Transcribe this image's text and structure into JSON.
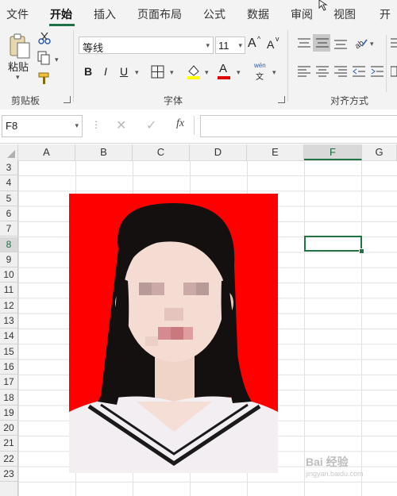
{
  "menu": {
    "tabs": [
      "文件",
      "开始",
      "插入",
      "页面布局",
      "公式",
      "数据",
      "审阅",
      "视图",
      "开"
    ],
    "active": "开始"
  },
  "ribbon": {
    "clipboard": {
      "paste_label": "粘贴",
      "group_label": "剪贴板"
    },
    "font": {
      "font_name": "等线",
      "font_size": "11",
      "bold": "B",
      "italic": "I",
      "underline": "U",
      "font_color_letter": "A",
      "phonetic_top": "wén",
      "phonetic_bottom": "文",
      "grow_font": "A",
      "shrink_font": "A",
      "group_label": "字体"
    },
    "alignment": {
      "group_label": "对齐方式"
    }
  },
  "formula_bar": {
    "name_box": "F8",
    "fx_label": "fx",
    "formula_value": ""
  },
  "grid": {
    "columns": [
      "A",
      "B",
      "C",
      "D",
      "E",
      "F",
      "G"
    ],
    "selected_column": "F",
    "rows": [
      "3",
      "4",
      "5",
      "6",
      "7",
      "8",
      "9",
      "10",
      "11",
      "12",
      "13",
      "14",
      "15",
      "16",
      "17",
      "18",
      "19",
      "20",
      "21",
      "22",
      "23"
    ],
    "selected_row": "8",
    "active_cell": "F8"
  },
  "photo": {
    "background_color": "#ff0000",
    "subject": "id-photo-portrait"
  },
  "watermark": {
    "text": "Bai 经验",
    "sub": "jingyan.baidu.com"
  }
}
